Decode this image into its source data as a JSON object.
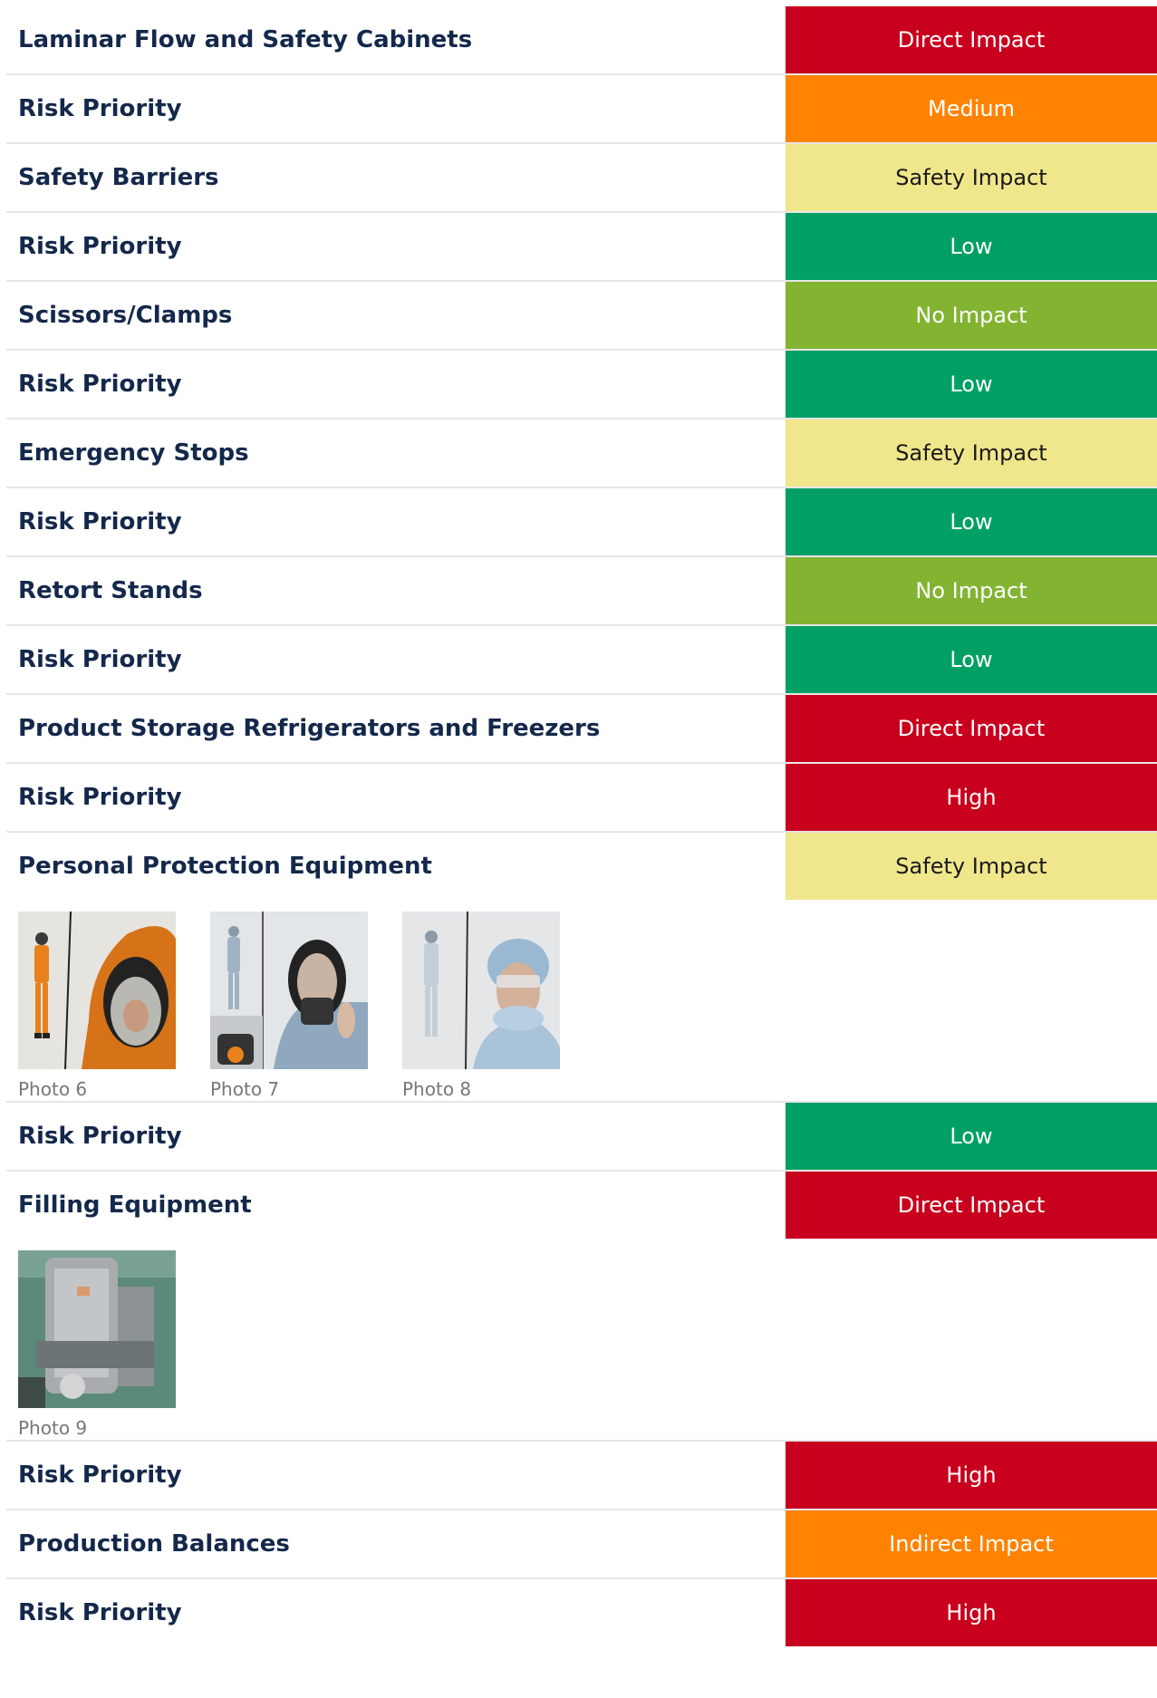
{
  "colors": {
    "direct": "#c8001e",
    "medium": "#ff8200",
    "safety": "#f0e68c",
    "low": "#00a064",
    "no_impact": "#82b432",
    "high": "#c8001e",
    "indirect": "#ff8200"
  },
  "rows": [
    {
      "label": "Laminar Flow and Safety Cabinets",
      "badge": "Direct Impact",
      "color": "#c8001e",
      "text_color": "#ffffff"
    },
    {
      "label": "Risk Priority",
      "badge": "Medium",
      "color": "#ff8200",
      "text_color": "#ffffff"
    },
    {
      "label": "Safety Barriers",
      "badge": "Safety Impact",
      "color": "#f0e68c",
      "text_color": "#1a1a1a"
    },
    {
      "label": "Risk Priority",
      "badge": "Low",
      "color": "#00a064",
      "text_color": "#ffffff"
    },
    {
      "label": "Scissors/Clamps",
      "badge": "No Impact",
      "color": "#82b432",
      "text_color": "#ffffff"
    },
    {
      "label": "Risk Priority",
      "badge": "Low",
      "color": "#00a064",
      "text_color": "#ffffff"
    },
    {
      "label": "Emergency Stops",
      "badge": "Safety Impact",
      "color": "#f0e68c",
      "text_color": "#1a1a1a"
    },
    {
      "label": "Risk Priority",
      "badge": "Low",
      "color": "#00a064",
      "text_color": "#ffffff"
    },
    {
      "label": "Retort Stands",
      "badge": "No Impact",
      "color": "#82b432",
      "text_color": "#ffffff"
    },
    {
      "label": "Risk Priority",
      "badge": "Low",
      "color": "#00a064",
      "text_color": "#ffffff"
    },
    {
      "label": "Product Storage Refrigerators and Freezers",
      "badge": "Direct Impact",
      "color": "#c8001e",
      "text_color": "#ffffff"
    },
    {
      "label": "Risk Priority",
      "badge": "High",
      "color": "#c8001e",
      "text_color": "#ffffff"
    },
    {
      "label": "Personal Protection Equipment",
      "badge": "Safety Impact",
      "color": "#f0e68c",
      "text_color": "#1a1a1a"
    }
  ],
  "ppe_photos": [
    {
      "caption": "Photo 6",
      "icon": "orange-suit-photo"
    },
    {
      "caption": "Photo 7",
      "icon": "respirator-photo"
    },
    {
      "caption": "Photo 8",
      "icon": "cleanroom-suit-photo"
    }
  ],
  "rows_after_ppe": [
    {
      "label": "Risk Priority",
      "badge": "Low",
      "color": "#00a064",
      "text_color": "#ffffff"
    },
    {
      "label": "Filling Equipment",
      "badge": "Direct Impact",
      "color": "#c8001e",
      "text_color": "#ffffff"
    }
  ],
  "filling_photos": [
    {
      "caption": "Photo 9",
      "icon": "filling-machine-photo"
    }
  ],
  "rows_final": [
    {
      "label": "Risk Priority",
      "badge": "High",
      "color": "#c8001e",
      "text_color": "#ffffff"
    },
    {
      "label": "Production Balances",
      "badge": "Indirect Impact",
      "color": "#ff8200",
      "text_color": "#ffffff"
    },
    {
      "label": "Risk Priority",
      "badge": "High",
      "color": "#c8001e",
      "text_color": "#ffffff"
    }
  ]
}
